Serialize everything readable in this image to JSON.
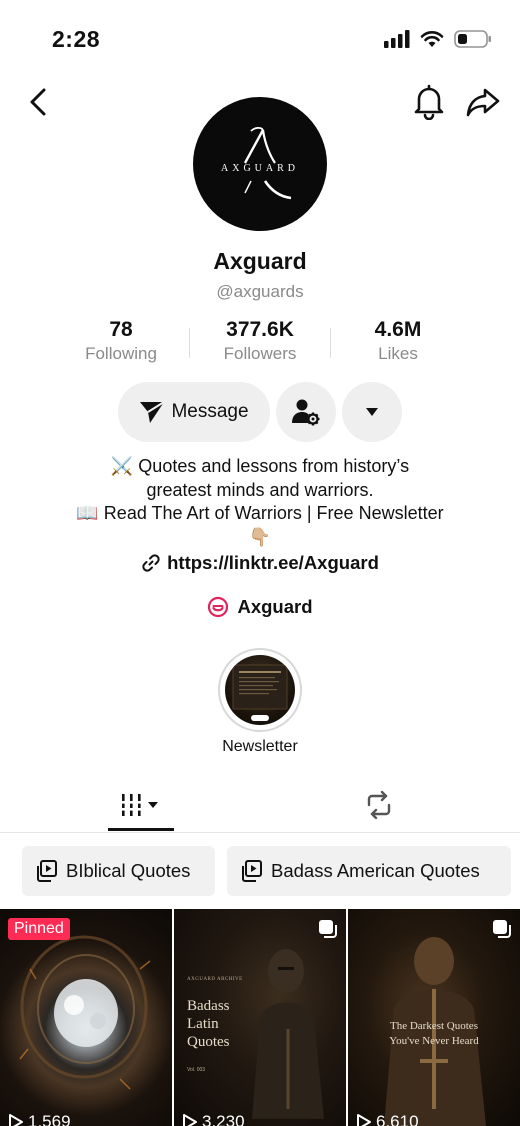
{
  "status_bar": {
    "time": "2:28"
  },
  "profile": {
    "logo_text": "AXGUARD",
    "name": "Axguard",
    "handle": "@axguards",
    "stats": [
      {
        "value": "78",
        "label": "Following"
      },
      {
        "value": "377.6K",
        "label": "Followers"
      },
      {
        "value": "4.6M",
        "label": "Likes"
      }
    ],
    "message_label": "Message",
    "bio_lines": [
      "⚔️ Quotes and lessons from history’s",
      "greatest minds and warriors.",
      "📖 Read The Art of Warriors | Free Newsletter",
      "👇🏼"
    ],
    "link": "https://linktr.ee/Axguard",
    "brand_link": "Axguard"
  },
  "highlight": {
    "label": "Newsletter"
  },
  "playlists": [
    "BIblical Quotes",
    "Badass American Quotes"
  ],
  "videos": [
    {
      "badge": "Pinned",
      "views": "1,569"
    },
    {
      "kicker": "AXGUARD ARCHIVE",
      "title_lines": [
        "Badass",
        "Latin",
        "Quotes"
      ],
      "vol": "Vol. 003",
      "views": "3,230"
    },
    {
      "title_lines": [
        "The Darkest Quotes",
        "You've Never Heard"
      ],
      "views": "6,610"
    }
  ],
  "colors": {
    "accent": "#fe2c55",
    "button_bg": "#efefef",
    "secondary_text": "#8a8a8a"
  }
}
